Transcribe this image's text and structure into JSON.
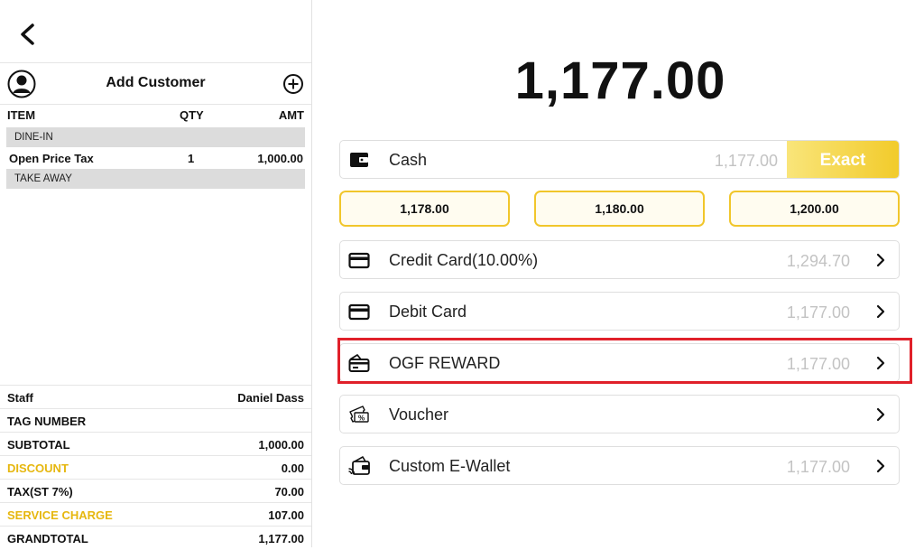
{
  "customer": {
    "label": "Add Customer"
  },
  "order": {
    "columns": {
      "item": "ITEM",
      "qty": "QTY",
      "amt": "AMT"
    },
    "sections": [
      {
        "label": "DINE-IN",
        "items": [
          {
            "name": "Open Price Tax",
            "qty": "1",
            "amount": "1,000.00"
          }
        ]
      },
      {
        "label": "TAKE AWAY",
        "items": []
      }
    ]
  },
  "summary": {
    "staff": {
      "label": "Staff",
      "value": "Daniel Dass"
    },
    "tag_number": {
      "label": "TAG NUMBER",
      "value": ""
    },
    "subtotal": {
      "label": "SUBTOTAL",
      "value": "1,000.00"
    },
    "discount": {
      "label": "DISCOUNT",
      "value": "0.00"
    },
    "tax": {
      "label": "TAX(ST 7%)",
      "value": "70.00"
    },
    "service_charge": {
      "label": "SERVICE CHARGE",
      "value": "107.00"
    },
    "grandtotal": {
      "label": "GRANDTOTAL",
      "value": "1,177.00"
    }
  },
  "payment": {
    "total": "1,177.00",
    "cash": {
      "label": "Cash",
      "amount": "1,177.00",
      "exact_label": "Exact"
    },
    "quick_amounts": [
      "1,178.00",
      "1,180.00",
      "1,200.00"
    ],
    "methods": [
      {
        "label": "Credit Card(10.00%)",
        "amount": "1,294.70",
        "icon": "credit-card-icon"
      },
      {
        "label": "Debit Card",
        "amount": "1,177.00",
        "icon": "debit-card-icon"
      },
      {
        "label": "OGF REWARD",
        "amount": "1,177.00",
        "icon": "reward-card-icon",
        "highlighted": true
      },
      {
        "label": "Voucher",
        "amount": "",
        "icon": "voucher-icon"
      },
      {
        "label": "Custom E-Wallet",
        "amount": "1,177.00",
        "icon": "ewallet-icon"
      }
    ]
  },
  "colors": {
    "accent": "#f2cb2b",
    "highlight": "#e0202a",
    "yellow_text": "#e6b70f"
  }
}
